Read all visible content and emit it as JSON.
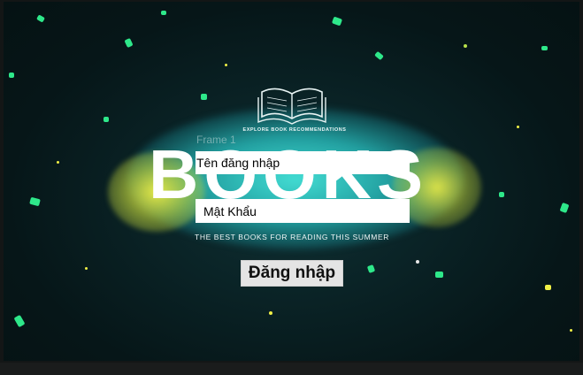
{
  "background": {
    "explore_caption": "EXPLORE BOOK RECOMMENDATIONS",
    "frame_label": "Frame 1",
    "title": "BOOKS",
    "tagline": "THE BEST BOOKS FOR READING THIS SUMMER",
    "colors": {
      "background": "#061618",
      "splash_teal": "#46e6dc",
      "splash_yellow": "#f0f046",
      "particle_green": "#2ee88a"
    },
    "icon": "open-book-icon"
  },
  "login_form": {
    "username_placeholder": "Tên đăng nhập",
    "password_placeholder": "Mật Khẩu",
    "submit_label": "Đăng nhập"
  }
}
